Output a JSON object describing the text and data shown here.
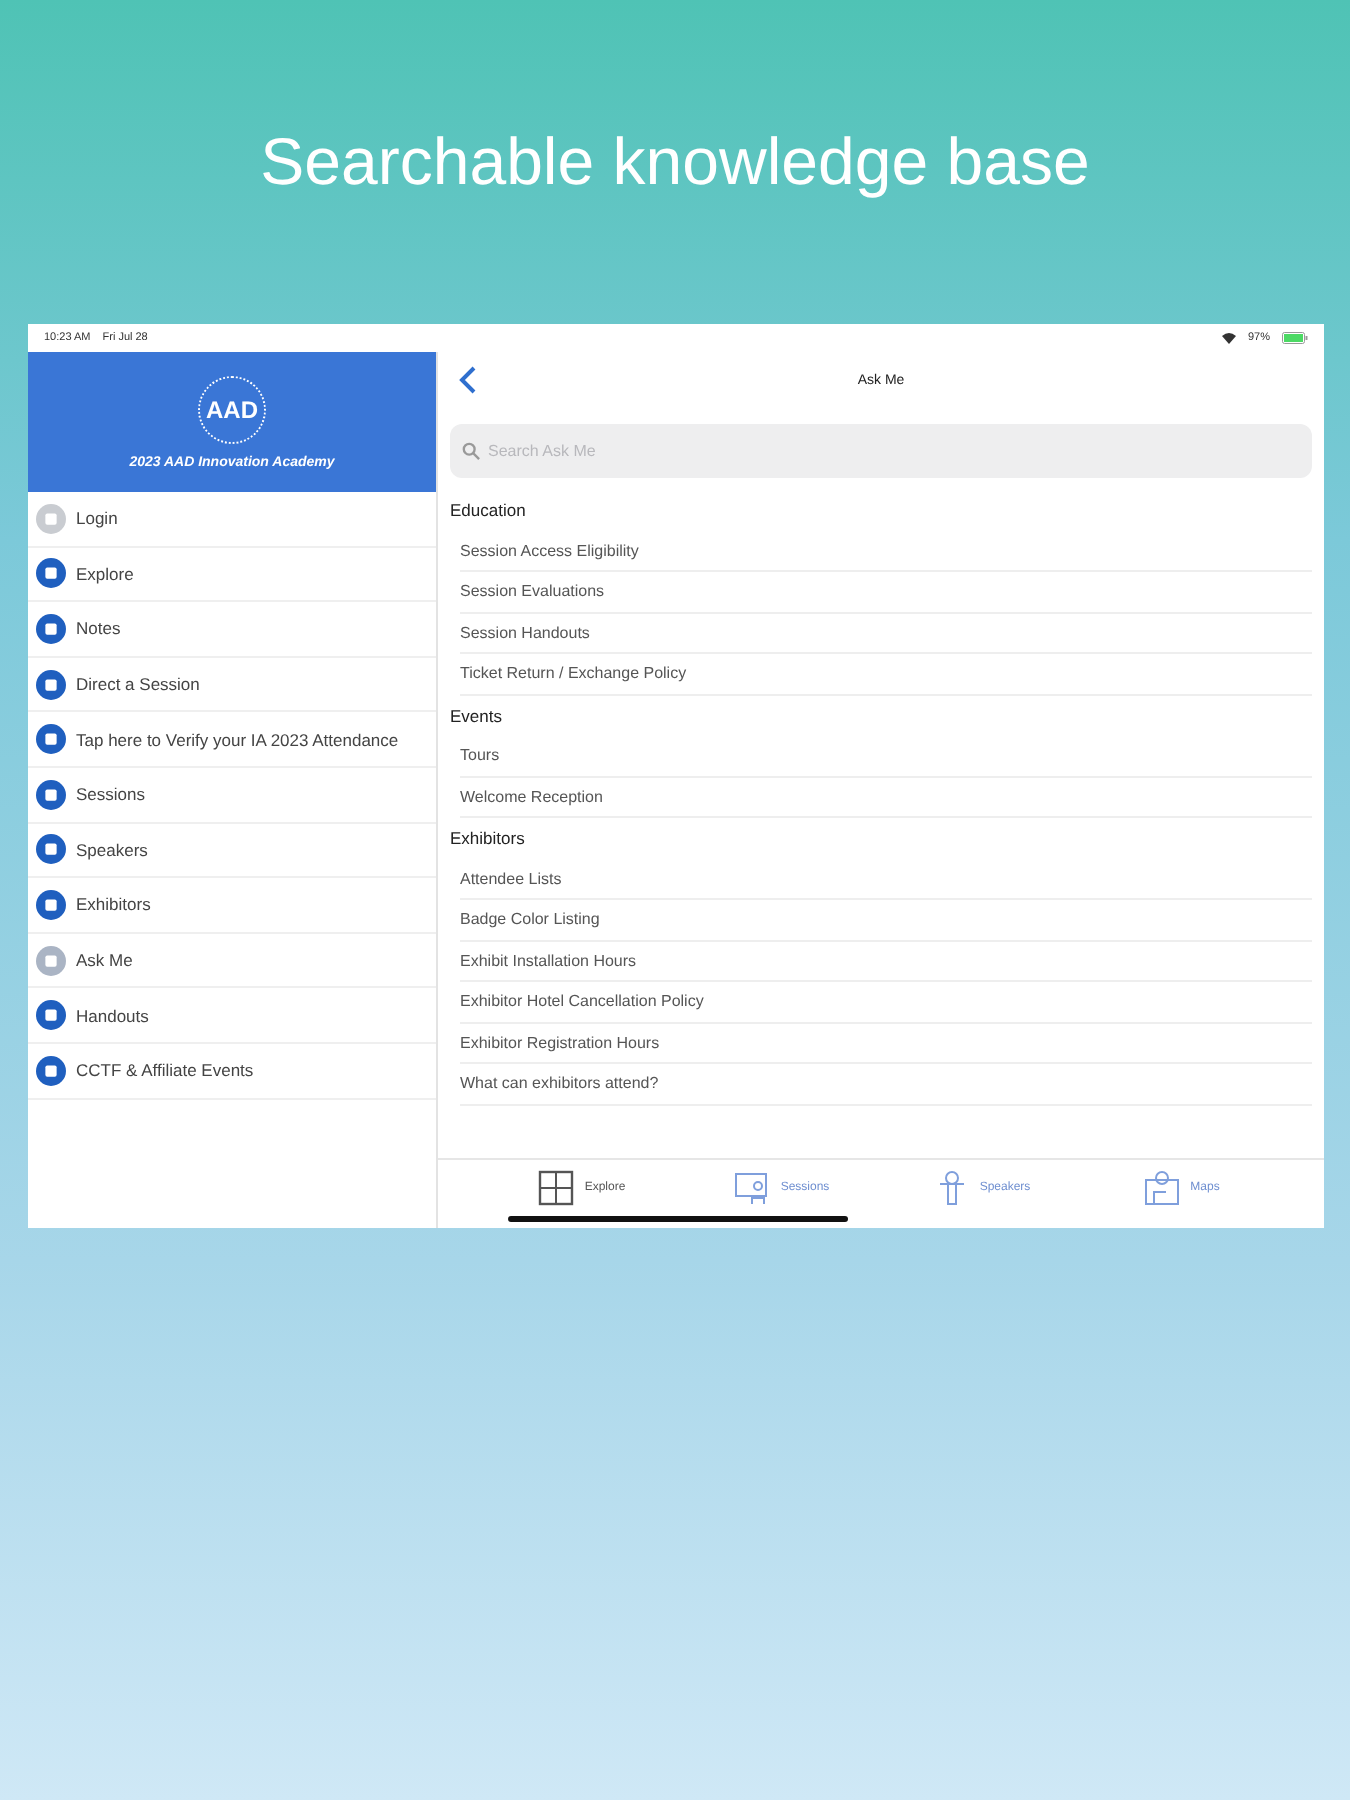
{
  "headline": "Searchable knowledge base",
  "status_bar": {
    "time": "10:23 AM",
    "date": "Fri Jul 28",
    "battery": "97%"
  },
  "sidebar": {
    "logo": "AAD",
    "title": "2023 AAD Innovation Academy",
    "items": [
      {
        "label": "Login",
        "color": "#c9ccd1"
      },
      {
        "label": "Explore",
        "color": "#1f5fbf"
      },
      {
        "label": "Notes",
        "color": "#1f5fbf"
      },
      {
        "label": "Direct a Session",
        "color": "#1f5fbf"
      },
      {
        "label": "Tap here to Verify your IA 2023 Attendance",
        "color": "#1f5fbf"
      },
      {
        "label": "Sessions",
        "color": "#1f5fbf"
      },
      {
        "label": "Speakers",
        "color": "#1f5fbf"
      },
      {
        "label": "Exhibitors",
        "color": "#1f5fbf"
      },
      {
        "label": "Ask Me",
        "color": "#aab4c4"
      },
      {
        "label": "Handouts",
        "color": "#1f5fbf"
      },
      {
        "label": "CCTF & Affiliate Events",
        "color": "#1f5fbf"
      }
    ]
  },
  "nav": {
    "title": "Ask Me"
  },
  "search": {
    "placeholder": "Search Ask Me"
  },
  "sections": [
    {
      "heading": "Education",
      "items": [
        "Session Access Eligibility",
        "Session Evaluations",
        "Session Handouts",
        "Ticket Return / Exchange Policy"
      ]
    },
    {
      "heading": "Events",
      "items": [
        "Tours",
        "Welcome Reception"
      ]
    },
    {
      "heading": "Exhibitors",
      "items": [
        "Attendee Lists",
        "Badge Color Listing",
        "Exhibit Installation Hours",
        "Exhibitor Hotel Cancellation Policy",
        "Exhibitor Registration Hours",
        "What can exhibitors attend?"
      ]
    }
  ],
  "tabs": [
    {
      "label": "Explore",
      "kind": "grid",
      "selected": true
    },
    {
      "label": "Sessions",
      "kind": "presenter",
      "selected": false
    },
    {
      "label": "Speakers",
      "kind": "speaker",
      "selected": false
    },
    {
      "label": "Maps",
      "kind": "map",
      "selected": false
    }
  ]
}
